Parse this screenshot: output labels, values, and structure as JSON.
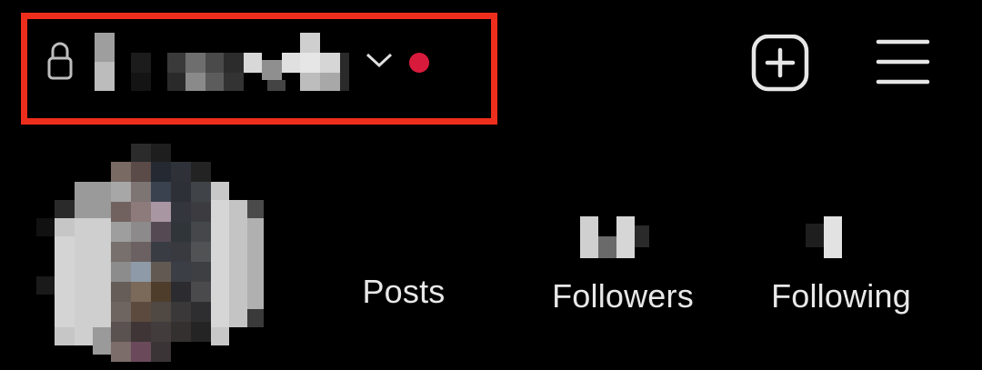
{
  "header": {
    "account_switcher": {
      "lock_icon": "lock-icon",
      "username_obscured": true,
      "chevron_icon": "chevron-down-icon",
      "notification_dot_color": "#d81b3c"
    },
    "highlight_color": "#ee2e1c",
    "actions": {
      "create_icon": "plus-square-icon",
      "menu_icon": "hamburger-menu-icon"
    }
  },
  "profile": {
    "avatar_obscured": true,
    "stats": {
      "posts_label": "Posts",
      "followers_label": "Followers",
      "following_label": "Following",
      "counts_obscured": true
    }
  }
}
